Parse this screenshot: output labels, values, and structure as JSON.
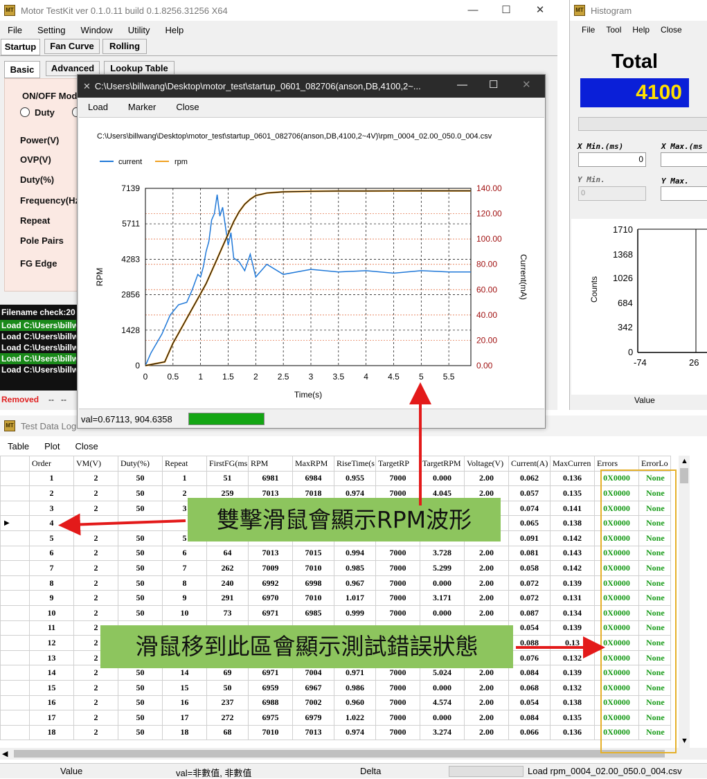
{
  "main_window": {
    "title": "Motor TestKit ver 0.1.0.11 build 0.1.8256.31256 X64",
    "menu": [
      "File",
      "Setting",
      "Window",
      "Utility",
      "Help"
    ],
    "tabs": [
      "Startup",
      "Fan Curve",
      "Rolling"
    ],
    "subtabs": [
      "Basic",
      "Advanced",
      "Lookup Table"
    ],
    "onoff_label": "ON/OFF Mode",
    "duty_radio": "Duty",
    "params": [
      "Power(V)",
      "OVP(V)",
      "Duty(%)",
      "Frequency(Hz",
      "Repeat",
      "Pole Pairs",
      "FG Edge"
    ],
    "log": [
      "Filename check:20",
      "Load C:\\Users\\billw",
      "Load C:\\Users\\billw",
      "Load C:\\Users\\billw",
      "Load C:\\Users\\billw",
      "Load C:\\Users\\billw"
    ],
    "removed": "Removed",
    "status_dashes": "--   --"
  },
  "histogram": {
    "title": "Histogram",
    "menu": [
      "File",
      "Tool",
      "Help",
      "Close"
    ],
    "total_label": "Total",
    "total_value": "4100",
    "x_min_label": "X Min.(ms)",
    "x_min_value": "0",
    "x_max_label": "X Max.(ms",
    "y_min_label": "Y Min.",
    "y_min_value": "0",
    "y_max_label": "Y Max.",
    "ylabel": "Counts",
    "yticks": [
      "1710",
      "1368",
      "1026",
      "684",
      "342",
      "0"
    ],
    "xticks": [
      "-74",
      "26"
    ],
    "value_label": "Value"
  },
  "plot_window": {
    "title": "C:\\Users\\billwang\\Desktop\\motor_test\\startup_0601_082706(anson,DB,4100,2~...",
    "menu": [
      "Load",
      "Marker",
      "Close"
    ],
    "status_value": "val=0.67113, 904.6358"
  },
  "chart_data": {
    "type": "line",
    "title": "C:\\Users\\billwang\\Desktop\\motor_test\\startup_0601_082706(anson,DB,4100,2~4V)\\rpm_0004_02.00_050.0_004.csv",
    "xlabel": "Time(s)",
    "ylabel": "RPM",
    "y2label": "Current(mA)",
    "xlim": [
      0,
      5.9
    ],
    "ylim": [
      0,
      7139
    ],
    "y2lim": [
      0,
      140
    ],
    "xticks": [
      "0",
      "0.5",
      "1",
      "1.5",
      "2",
      "2.5",
      "3",
      "3.5",
      "4",
      "4.5",
      "5",
      "5.5"
    ],
    "yticks": [
      "0",
      "1428",
      "2856",
      "4283",
      "5711",
      "7139"
    ],
    "y2ticks": [
      "0.00",
      "20.00",
      "40.00",
      "60.00",
      "80.00",
      "100.00",
      "120.00",
      "140.00"
    ],
    "legend": "top-left",
    "grid": true,
    "colors": {
      "current": "#1f78d8",
      "rpm": "#f0a020",
      "rpm_trace": "#111111"
    },
    "series": [
      {
        "name": "current",
        "axis": "y2",
        "x": [
          0,
          0.1,
          0.3,
          0.45,
          0.6,
          0.75,
          0.85,
          0.95,
          1.0,
          1.05,
          1.1,
          1.15,
          1.2,
          1.25,
          1.3,
          1.35,
          1.4,
          1.45,
          1.5,
          1.55,
          1.6,
          1.7,
          1.8,
          1.9,
          2.0,
          2.2,
          2.5,
          3.0,
          3.5,
          4.0,
          4.5,
          5.0,
          5.5,
          5.9
        ],
        "y": [
          0,
          10,
          25,
          40,
          48,
          50,
          60,
          72,
          70,
          78,
          90,
          98,
          115,
          120,
          135,
          118,
          125,
          110,
          95,
          105,
          85,
          82,
          75,
          88,
          70,
          80,
          72,
          76,
          74,
          75,
          73,
          75,
          74,
          74
        ]
      },
      {
        "name": "rpm",
        "axis": "y",
        "x": [
          0,
          0.35,
          0.5,
          0.6,
          0.7,
          0.8,
          0.9,
          1.0,
          1.1,
          1.2,
          1.3,
          1.4,
          1.5,
          1.6,
          1.7,
          1.8,
          1.9,
          2.0,
          2.2,
          2.5,
          3.0,
          3.5,
          4.0,
          4.5,
          5.0,
          5.5,
          5.9
        ],
        "y": [
          0,
          150,
          900,
          1300,
          1700,
          2100,
          2500,
          2900,
          3300,
          3800,
          4300,
          4800,
          5300,
          5800,
          6200,
          6500,
          6700,
          6850,
          6950,
          7000,
          7020,
          7030,
          7030,
          7035,
          7040,
          7040,
          7040
        ]
      }
    ]
  },
  "data_log": {
    "title": "Test Data Log",
    "menu": [
      "Table",
      "Plot",
      "Close"
    ],
    "columns": [
      "Order",
      "VM(V)",
      "Duty(%)",
      "Repeat",
      "FirstFG(ms",
      "RPM",
      "MaxRPM",
      "RiseTime(s",
      "TargetRP",
      "TargetRPM",
      "Voltage(V)",
      "Current(A)",
      "MaxCurren",
      "Errors",
      "ErrorLo"
    ],
    "rows": [
      [
        "1",
        "2",
        "50",
        "1",
        "51",
        "6981",
        "6984",
        "0.955",
        "7000",
        "0.000",
        "2.00",
        "0.062",
        "0.136",
        "0X0000",
        "None"
      ],
      [
        "2",
        "2",
        "50",
        "2",
        "259",
        "7013",
        "7018",
        "0.974",
        "7000",
        "4.045",
        "2.00",
        "0.057",
        "0.135",
        "0X0000",
        "None"
      ],
      [
        "3",
        "2",
        "50",
        "3",
        "",
        "",
        "",
        "",
        "",
        "",
        "",
        "0.074",
        "0.141",
        "0X0000",
        "None"
      ],
      [
        "4",
        "",
        "",
        "",
        "",
        "",
        "",
        "",
        "",
        "",
        "",
        "0.065",
        "0.138",
        "0X0000",
        "None"
      ],
      [
        "5",
        "2",
        "50",
        "5",
        "",
        "",
        "",
        "",
        "",
        "",
        "",
        "0.091",
        "0.142",
        "0X0000",
        "None"
      ],
      [
        "6",
        "2",
        "50",
        "6",
        "64",
        "7013",
        "7015",
        "0.994",
        "7000",
        "3.728",
        "2.00",
        "0.081",
        "0.143",
        "0X0000",
        "None"
      ],
      [
        "7",
        "2",
        "50",
        "7",
        "262",
        "7009",
        "7010",
        "0.985",
        "7000",
        "5.299",
        "2.00",
        "0.058",
        "0.142",
        "0X0000",
        "None"
      ],
      [
        "8",
        "2",
        "50",
        "8",
        "240",
        "6992",
        "6998",
        "0.967",
        "7000",
        "0.000",
        "2.00",
        "0.072",
        "0.139",
        "0X0000",
        "None"
      ],
      [
        "9",
        "2",
        "50",
        "9",
        "291",
        "6970",
        "7010",
        "1.017",
        "7000",
        "3.171",
        "2.00",
        "0.072",
        "0.131",
        "0X0000",
        "None"
      ],
      [
        "10",
        "2",
        "50",
        "10",
        "73",
        "6971",
        "6985",
        "0.999",
        "7000",
        "0.000",
        "2.00",
        "0.087",
        "0.134",
        "0X0000",
        "None"
      ],
      [
        "11",
        "2",
        "",
        "",
        "",
        "",
        "",
        "",
        "",
        "",
        "",
        "0.054",
        "0.139",
        "0X0000",
        "None"
      ],
      [
        "12",
        "2",
        "",
        "",
        "",
        "",
        "",
        "",
        "",
        "",
        "",
        "0.088",
        "0.13",
        "0X0000",
        "None"
      ],
      [
        "13",
        "2",
        "",
        "",
        "",
        "",
        "",
        "",
        "",
        "",
        "",
        "0.076",
        "0.132",
        "0X0000",
        "None"
      ],
      [
        "14",
        "2",
        "50",
        "14",
        "69",
        "6971",
        "7004",
        "0.971",
        "7000",
        "5.024",
        "2.00",
        "0.084",
        "0.139",
        "0X0000",
        "None"
      ],
      [
        "15",
        "2",
        "50",
        "15",
        "50",
        "6959",
        "6967",
        "0.986",
        "7000",
        "0.000",
        "2.00",
        "0.068",
        "0.132",
        "0X0000",
        "None"
      ],
      [
        "16",
        "2",
        "50",
        "16",
        "237",
        "6988",
        "7002",
        "0.960",
        "7000",
        "4.574",
        "2.00",
        "0.054",
        "0.138",
        "0X0000",
        "None"
      ],
      [
        "17",
        "2",
        "50",
        "17",
        "272",
        "6975",
        "6979",
        "1.022",
        "7000",
        "0.000",
        "2.00",
        "0.084",
        "0.135",
        "0X0000",
        "None"
      ],
      [
        "18",
        "2",
        "50",
        "18",
        "68",
        "7010",
        "7013",
        "0.974",
        "7000",
        "3.274",
        "2.00",
        "0.066",
        "0.136",
        "0X0000",
        "None"
      ]
    ],
    "status": {
      "value": "Value",
      "val": "val=非數值, 非數值",
      "delta": "Delta",
      "load": "Load rpm_0004_02.00_050.0_004.csv"
    }
  },
  "annotations": {
    "callout1": "雙擊滑鼠會顯示RPM波形",
    "callout2": "滑鼠移到此區會顯示測試錯誤狀態"
  }
}
